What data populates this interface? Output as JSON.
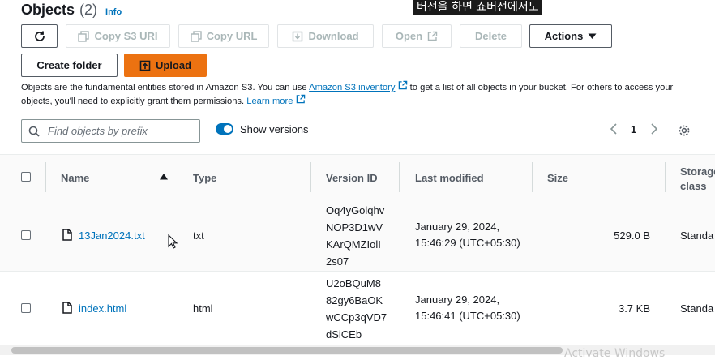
{
  "header": {
    "title": "Objects",
    "count": "(2)",
    "info": "Info"
  },
  "caption": "버전을 하면 쇼버전에서도",
  "toolbar": {
    "copy_s3_uri": "Copy S3 URI",
    "copy_url": "Copy URL",
    "download": "Download",
    "open": "Open",
    "delete": "Delete",
    "actions": "Actions",
    "create_folder": "Create folder",
    "upload": "Upload"
  },
  "description": {
    "part1": "Objects are the fundamental entities stored in Amazon S3. You can use ",
    "link1": "Amazon S3 inventory",
    "part2": " to get a list of all objects in your bucket. For others to access your objects, you'll need to explicitly grant them permissions. ",
    "link2": "Learn more"
  },
  "search": {
    "placeholder": "Find objects by prefix"
  },
  "versions_toggle": {
    "label": "Show versions",
    "enabled": true
  },
  "pagination": {
    "page": "1"
  },
  "table": {
    "columns": [
      "Name",
      "Type",
      "Version ID",
      "Last modified",
      "Size",
      "Storage",
      "class"
    ],
    "rows": [
      {
        "name": "13Jan2024.txt",
        "type": "txt",
        "version_lines": [
          "Oq4yGolqhv",
          "NOP3D1wV",
          "KArQMZIolI",
          "2s07"
        ],
        "modified_lines": [
          "January 29, 2024,",
          "15:46:29 (UTC+05:30)"
        ],
        "size": "529.0 B",
        "storage": "Standa"
      },
      {
        "name": "index.html",
        "type": "html",
        "version_lines": [
          "U2oBQuM8",
          "82gy6BaOK",
          "wCCp3qVD7",
          "dSiCEb"
        ],
        "modified_lines": [
          "January 29, 2024,",
          "15:46:41 (UTC+05:30)"
        ],
        "size": "3.7 KB",
        "storage": "Standa"
      }
    ]
  },
  "watermark": "Activate Windows",
  "colors": {
    "accent": "#0073bb",
    "upload": "#ec7211",
    "text": "#16191f"
  }
}
